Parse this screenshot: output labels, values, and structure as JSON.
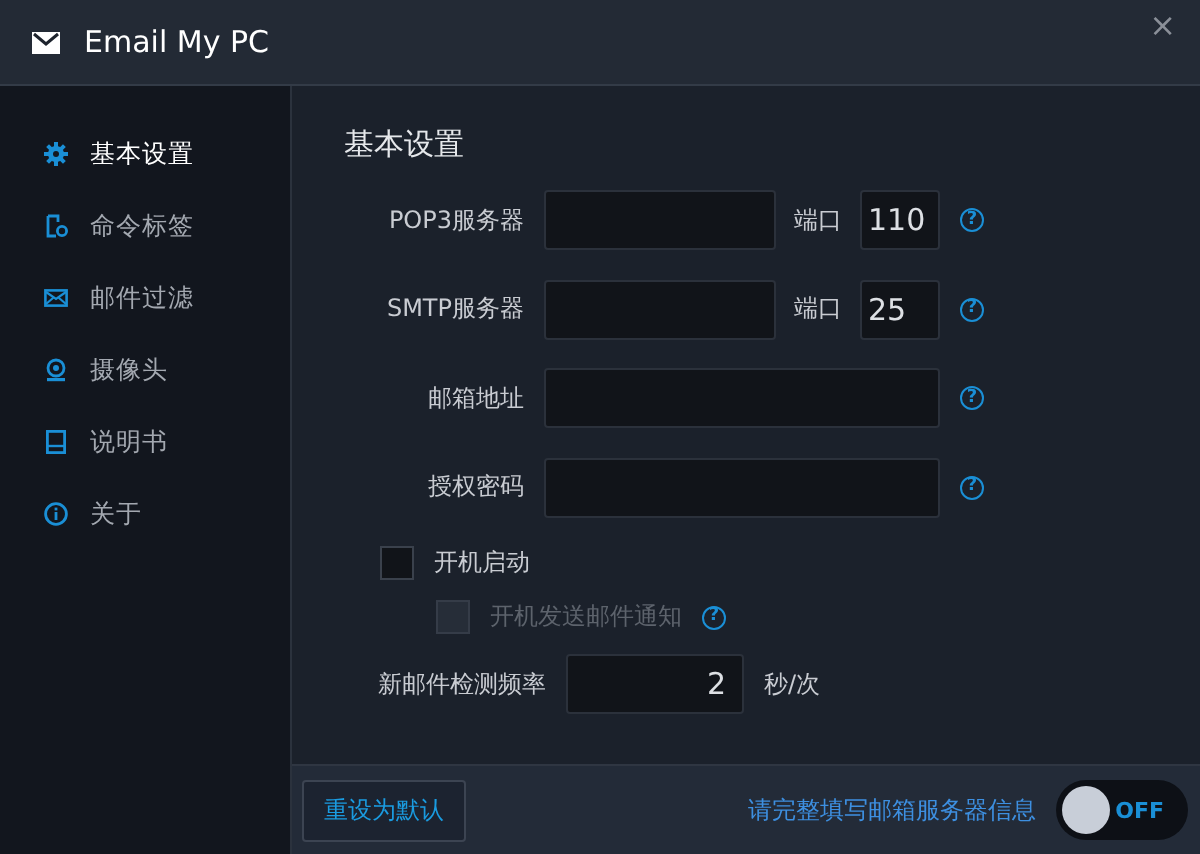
{
  "window": {
    "title": "Email My PC",
    "close": "×"
  },
  "sidebar": {
    "items": [
      {
        "label": "基本设置",
        "selected": true
      },
      {
        "label": "命令标签",
        "selected": false
      },
      {
        "label": "邮件过滤",
        "selected": false
      },
      {
        "label": "摄像头",
        "selected": false
      },
      {
        "label": "说明书",
        "selected": false
      },
      {
        "label": "关于",
        "selected": false
      }
    ]
  },
  "content": {
    "heading": "基本设置",
    "rows": [
      {
        "kind": "server",
        "label": "POP3服务器",
        "value": "",
        "port_label": "端口",
        "port": "110",
        "help": "?"
      },
      {
        "kind": "server",
        "label": "SMTP服务器",
        "value": "",
        "port_label": "端口",
        "port": "25",
        "help": "?"
      },
      {
        "kind": "wide",
        "label": "邮箱地址",
        "value": "",
        "help": "?"
      },
      {
        "kind": "wide",
        "label": "授权密码",
        "value": "",
        "help": "?"
      }
    ],
    "checkboxes": [
      {
        "label": "开机启动",
        "checked": false,
        "disabled": false
      },
      {
        "label": "开机发送邮件通知",
        "checked": false,
        "disabled": true,
        "help": "?"
      }
    ],
    "frequency": {
      "label": "新邮件检测频率",
      "value": "2",
      "unit": "秒/次"
    }
  },
  "footer": {
    "reset_button": "重设为默认",
    "message": "请完整填写邮箱服务器信息",
    "toggle": {
      "on": false,
      "label": "OFF"
    }
  }
}
